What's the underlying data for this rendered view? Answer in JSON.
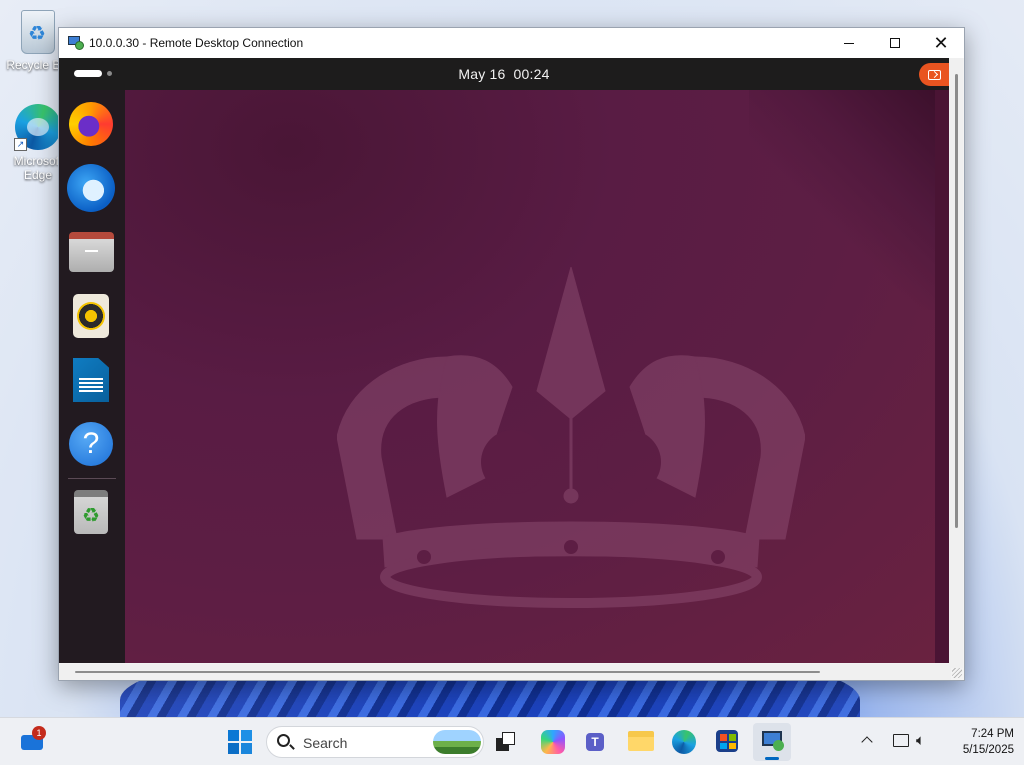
{
  "desktop": {
    "icons": [
      {
        "label": "Recycle Bin"
      },
      {
        "label": "Microsoft Edge"
      }
    ]
  },
  "rdp_window": {
    "title": "10.0.0.30 - Remote Desktop Connection",
    "controls": {
      "minimize": "minimize",
      "maximize": "maximize",
      "close": "close"
    }
  },
  "ubuntu": {
    "topbar": {
      "date": "May 16",
      "time": "00:24"
    },
    "dock": [
      {
        "app": "Firefox",
        "icon": "firefox-icon"
      },
      {
        "app": "Thunderbird",
        "icon": "thunderbird-icon"
      },
      {
        "app": "Files",
        "icon": "files-icon"
      },
      {
        "app": "Rhythmbox",
        "icon": "rhythmbox-icon"
      },
      {
        "app": "LibreOffice Writer",
        "icon": "libreoffice-writer-icon"
      },
      {
        "app": "Help",
        "icon": "help-icon",
        "glyph": "?"
      },
      {
        "app": "Trash",
        "icon": "trash-icon",
        "glyph": "♻"
      }
    ]
  },
  "taskbar": {
    "widgets_badge": "1",
    "search_placeholder": "Search",
    "tray": {
      "time": "7:24 PM",
      "date": "5/15/2025"
    },
    "colors": {
      "accent": "#0067c0",
      "ubuntu_orange": "#e95420"
    }
  }
}
